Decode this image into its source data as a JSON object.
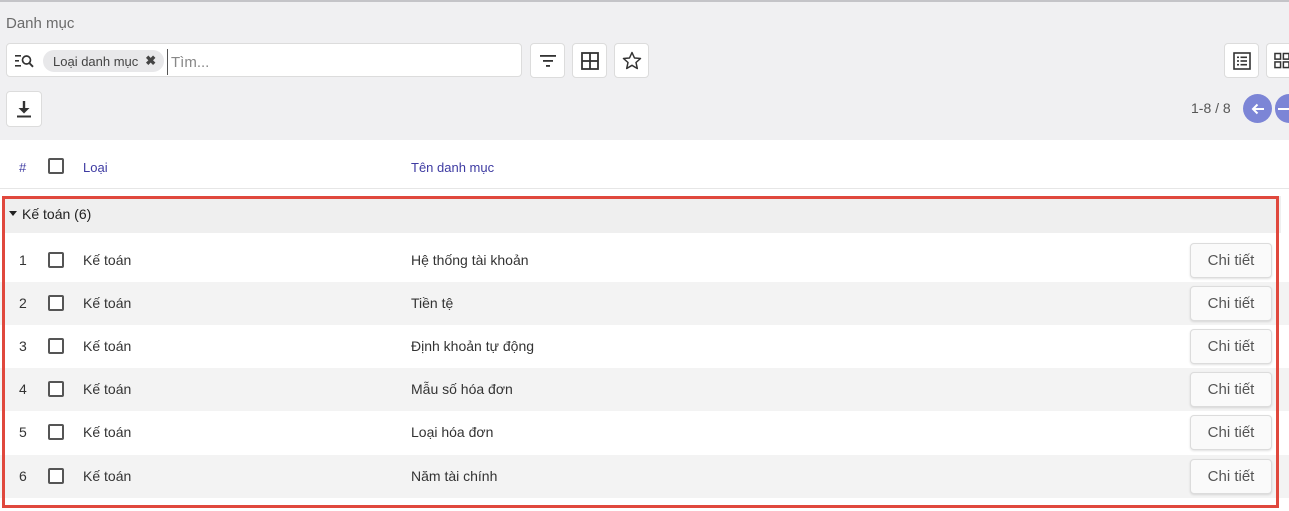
{
  "page_title": "Danh mục",
  "search": {
    "facet_label": "Loại danh mục",
    "facet_remove": "✖",
    "placeholder": "Tìm...",
    "value": ""
  },
  "pager": {
    "range": "1-8 / 8"
  },
  "table": {
    "columns": {
      "index": "#",
      "type": "Loại",
      "name": "Tên danh mục"
    },
    "group": {
      "label": "Kế toán (6)"
    },
    "rows": [
      {
        "num": "1",
        "type": "Kế toán",
        "name": "Hệ thống tài khoản",
        "action": "Chi tiết"
      },
      {
        "num": "2",
        "type": "Kế toán",
        "name": "Tiền tệ",
        "action": "Chi tiết"
      },
      {
        "num": "3",
        "type": "Kế toán",
        "name": "Định khoản tự động",
        "action": "Chi tiết"
      },
      {
        "num": "4",
        "type": "Kế toán",
        "name": "Mẫu số hóa đơn",
        "action": "Chi tiết"
      },
      {
        "num": "5",
        "type": "Kế toán",
        "name": "Loại hóa đơn",
        "action": "Chi tiết"
      },
      {
        "num": "6",
        "type": "Kế toán",
        "name": "Năm tài chính",
        "action": "Chi tiết"
      }
    ]
  },
  "colors": {
    "accent": "#3e3ba2",
    "pager": "#7c85d6",
    "highlight": "#e0483d"
  },
  "icons": [
    "search-icon",
    "filter-icon",
    "group-by-icon",
    "favorite-star-icon",
    "list-view-icon",
    "kanban-view-icon",
    "download-icon",
    "arrow-left-icon",
    "arrow-right-icon",
    "caret-down-icon"
  ]
}
